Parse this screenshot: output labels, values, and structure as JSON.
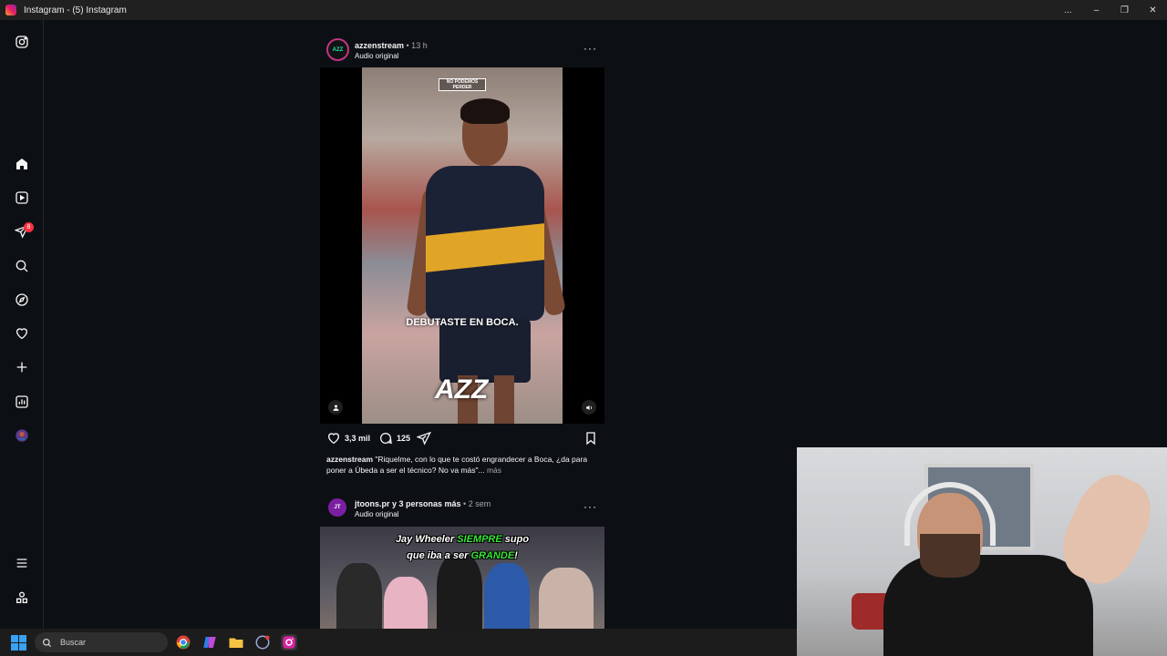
{
  "window": {
    "title": "Instagram - (5) Instagram",
    "controls": [
      "...",
      "–",
      "❐",
      "✕"
    ]
  },
  "sidebar": {
    "items": [
      {
        "name": "instagram-logo",
        "icon": "instagram-icon"
      },
      {
        "name": "home",
        "icon": "home-icon"
      },
      {
        "name": "reels",
        "icon": "reels-icon"
      },
      {
        "name": "messages",
        "icon": "messages-icon",
        "badge": "8"
      },
      {
        "name": "search",
        "icon": "search-icon"
      },
      {
        "name": "explore",
        "icon": "compass-icon"
      },
      {
        "name": "notifications",
        "icon": "heart-icon"
      },
      {
        "name": "create",
        "icon": "plus-icon"
      },
      {
        "name": "dashboard",
        "icon": "chart-icon"
      },
      {
        "name": "profile",
        "icon": "avatar"
      },
      {
        "name": "more",
        "icon": "menu-icon"
      },
      {
        "name": "also-from-meta",
        "icon": "threads-icon"
      }
    ]
  },
  "post1": {
    "avatar_text": "AZZ",
    "username": "azzenstream",
    "time": " • 13 h",
    "audio": "Audio original",
    "more": "···",
    "overlay_logo": "NO PODEMOS PERDER",
    "overlay_text": "DEBUTASTE EN BOCA.",
    "overlay_mark": "AZZ",
    "likes": "3,3 mil",
    "comments": "125",
    "caption_user": "azzenstream",
    "caption_text": " \"Riquelme, con lo que te costó engrandecer a Boca, ¿da para poner a Úbeda a ser el técnico? No va más\"...",
    "caption_more": " más"
  },
  "post2": {
    "avatar_text": "JT",
    "username": "jtoons.pr y 3 personas más",
    "time": " • 2 sem",
    "audio": "Audio original",
    "more": "···",
    "line1_a": "Jay Wheeler ",
    "line1_b": "SIEMPRE",
    "line1_c": " supo",
    "line2_a": "que iba a ser ",
    "line2_b": "GRANDE",
    "line2_c": "!"
  },
  "taskbar": {
    "search_placeholder": "Buscar",
    "apps": [
      "chrome-icon",
      "copilot-icon",
      "file-explorer-icon",
      "app-icon",
      "instagram-icon"
    ]
  },
  "colors": {
    "background": "#0c1014",
    "badge": "#ff3040",
    "accent_green": "#39e639"
  }
}
